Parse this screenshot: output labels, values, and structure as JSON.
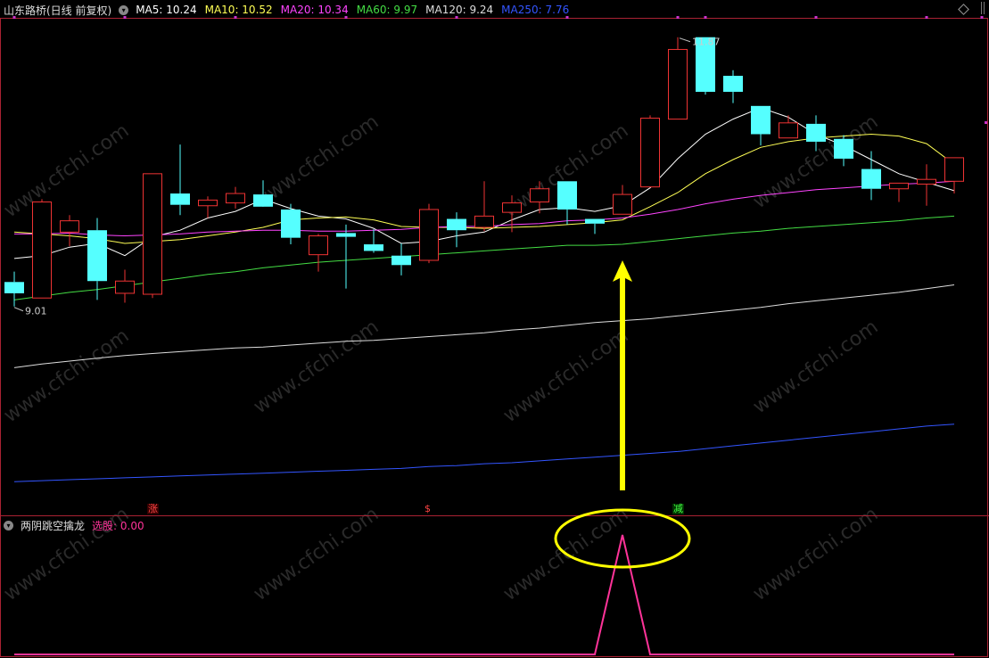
{
  "header": {
    "stock_title": "山东路桥(日线 前复权)",
    "ma_labels": [
      {
        "text": "MA5: 10.24",
        "color": "#ffffff"
      },
      {
        "text": "MA10: 10.52",
        "color": "#ffff55"
      },
      {
        "text": "MA20: 10.34",
        "color": "#ff44ff"
      },
      {
        "text": "MA60: 9.97",
        "color": "#44dd44"
      },
      {
        "text": "MA120: 9.24",
        "color": "#dddddd"
      },
      {
        "text": "MA250: 7.76",
        "color": "#3355ff"
      }
    ]
  },
  "indicator_panel": {
    "title": "两阴跳空擒龙",
    "value_label": "选股: 0.00",
    "value_color": "#ff3399"
  },
  "annotations": {
    "high_price": "11.87",
    "low_price": "9.01",
    "signal_zhang": "涨",
    "signal_s": "$",
    "signal_jian": "减"
  },
  "watermark": "www.cfchi.com",
  "colors": {
    "up": "#ee3333",
    "down": "#55ffff",
    "ma5": "#ffffff",
    "ma10": "#ffff55",
    "ma20": "#ff44ff",
    "ma60": "#44dd44",
    "ma120": "#dddddd",
    "ma250": "#3355ff",
    "indicator": "#ff3399",
    "highlight": "#ffff00",
    "frame": "#aa2233"
  },
  "chart_data": {
    "type": "candlestick",
    "candles": [
      {
        "o": 9.27,
        "h": 9.38,
        "l": 9.01,
        "c": 9.15
      },
      {
        "o": 9.1,
        "h": 10.15,
        "l": 9.1,
        "c": 10.12
      },
      {
        "o": 9.8,
        "h": 9.98,
        "l": 9.65,
        "c": 9.92
      },
      {
        "o": 9.82,
        "h": 9.95,
        "l": 9.08,
        "c": 9.28
      },
      {
        "o": 9.15,
        "h": 9.4,
        "l": 9.05,
        "c": 9.28
      },
      {
        "o": 9.14,
        "h": 10.42,
        "l": 9.1,
        "c": 10.42
      },
      {
        "o": 10.21,
        "h": 10.73,
        "l": 9.98,
        "c": 10.09
      },
      {
        "o": 10.08,
        "h": 10.18,
        "l": 9.95,
        "c": 10.14
      },
      {
        "o": 10.11,
        "h": 10.28,
        "l": 10.05,
        "c": 10.21
      },
      {
        "o": 10.2,
        "h": 10.35,
        "l": 10.08,
        "c": 10.07
      },
      {
        "o": 10.04,
        "h": 10.1,
        "l": 9.67,
        "c": 9.74
      },
      {
        "o": 9.56,
        "h": 9.78,
        "l": 9.38,
        "c": 9.76
      },
      {
        "o": 9.79,
        "h": 9.88,
        "l": 9.2,
        "c": 9.75
      },
      {
        "o": 9.67,
        "h": 9.83,
        "l": 9.58,
        "c": 9.6
      },
      {
        "o": 9.55,
        "h": 9.68,
        "l": 9.34,
        "c": 9.45
      },
      {
        "o": 9.5,
        "h": 10.1,
        "l": 9.47,
        "c": 10.04
      },
      {
        "o": 9.94,
        "h": 10.01,
        "l": 9.64,
        "c": 9.82
      },
      {
        "o": 9.85,
        "h": 10.34,
        "l": 9.81,
        "c": 9.97
      },
      {
        "o": 10.01,
        "h": 10.19,
        "l": 9.8,
        "c": 10.11
      },
      {
        "o": 10.12,
        "h": 10.34,
        "l": 10.0,
        "c": 10.26
      },
      {
        "o": 10.34,
        "h": 10.34,
        "l": 9.88,
        "c": 10.04
      },
      {
        "o": 9.94,
        "h": 9.94,
        "l": 9.78,
        "c": 9.89
      },
      {
        "o": 9.99,
        "h": 10.3,
        "l": 9.99,
        "c": 10.2
      },
      {
        "o": 10.28,
        "h": 11.04,
        "l": 10.28,
        "c": 11.01
      },
      {
        "o": 11.0,
        "h": 11.87,
        "l": 11.0,
        "c": 11.74
      },
      {
        "o": 11.87,
        "h": 11.87,
        "l": 11.26,
        "c": 11.29
      },
      {
        "o": 11.46,
        "h": 11.52,
        "l": 11.17,
        "c": 11.29
      },
      {
        "o": 11.14,
        "h": 11.14,
        "l": 10.72,
        "c": 10.84
      },
      {
        "o": 10.8,
        "h": 11.04,
        "l": 10.8,
        "c": 10.96
      },
      {
        "o": 10.95,
        "h": 11.04,
        "l": 10.66,
        "c": 10.76
      },
      {
        "o": 10.79,
        "h": 10.83,
        "l": 10.5,
        "c": 10.58
      },
      {
        "o": 10.47,
        "h": 10.66,
        "l": 10.14,
        "c": 10.26
      },
      {
        "o": 10.26,
        "h": 10.32,
        "l": 10.12,
        "c": 10.32
      },
      {
        "o": 10.31,
        "h": 10.52,
        "l": 10.08,
        "c": 10.36
      },
      {
        "o": 10.34,
        "h": 10.59,
        "l": 10.21,
        "c": 10.59
      }
    ],
    "ma_series": [
      {
        "name": "MA5",
        "values": [
          9.52,
          9.55,
          9.64,
          9.68,
          9.55,
          9.75,
          9.82,
          9.95,
          10.02,
          10.15,
          10.05,
          9.97,
          9.94,
          9.84,
          9.68,
          9.7,
          9.76,
          9.8,
          9.93,
          10.04,
          10.06,
          10.02,
          10.08,
          10.27,
          10.58,
          10.84,
          11.0,
          11.12,
          11.02,
          10.84,
          10.72,
          10.57,
          10.42,
          10.33,
          10.24
        ]
      },
      {
        "name": "MA10",
        "values": [
          9.8,
          9.78,
          9.76,
          9.73,
          9.68,
          9.7,
          9.72,
          9.76,
          9.8,
          9.85,
          9.93,
          9.95,
          9.96,
          9.93,
          9.86,
          9.85,
          9.85,
          9.84,
          9.85,
          9.86,
          9.88,
          9.9,
          9.93,
          10.07,
          10.22,
          10.42,
          10.57,
          10.7,
          10.76,
          10.8,
          10.82,
          10.84,
          10.82,
          10.74,
          10.52
        ]
      },
      {
        "name": "MA20",
        "values": [
          9.78,
          9.78,
          9.79,
          9.77,
          9.76,
          9.77,
          9.78,
          9.8,
          9.81,
          9.82,
          9.82,
          9.81,
          9.81,
          9.82,
          9.83,
          9.85,
          9.86,
          9.86,
          9.88,
          9.89,
          9.92,
          9.93,
          9.95,
          9.99,
          10.04,
          10.1,
          10.15,
          10.19,
          10.22,
          10.25,
          10.27,
          10.29,
          10.31,
          10.32,
          10.34
        ]
      },
      {
        "name": "MA60",
        "values": [
          9.08,
          9.12,
          9.16,
          9.19,
          9.23,
          9.27,
          9.31,
          9.35,
          9.38,
          9.42,
          9.45,
          9.48,
          9.5,
          9.52,
          9.54,
          9.56,
          9.58,
          9.6,
          9.62,
          9.64,
          9.66,
          9.66,
          9.67,
          9.7,
          9.73,
          9.76,
          9.79,
          9.81,
          9.84,
          9.86,
          9.88,
          9.9,
          9.92,
          9.95,
          9.97
        ]
      },
      {
        "name": "MA120",
        "values": [
          8.36,
          8.4,
          8.43,
          8.46,
          8.49,
          8.51,
          8.53,
          8.55,
          8.57,
          8.58,
          8.6,
          8.62,
          8.64,
          8.65,
          8.67,
          8.69,
          8.71,
          8.73,
          8.76,
          8.78,
          8.81,
          8.84,
          8.86,
          8.88,
          8.91,
          8.94,
          8.97,
          9.0,
          9.04,
          9.07,
          9.1,
          9.13,
          9.16,
          9.2,
          9.24
        ]
      },
      {
        "name": "MA250",
        "values": [
          7.15,
          7.16,
          7.17,
          7.18,
          7.19,
          7.2,
          7.21,
          7.22,
          7.23,
          7.24,
          7.25,
          7.26,
          7.27,
          7.28,
          7.29,
          7.31,
          7.32,
          7.34,
          7.35,
          7.37,
          7.39,
          7.41,
          7.43,
          7.45,
          7.47,
          7.5,
          7.53,
          7.56,
          7.59,
          7.62,
          7.65,
          7.68,
          7.71,
          7.74,
          7.76
        ]
      }
    ],
    "indicator": {
      "name": "选股",
      "values": [
        0,
        0,
        0,
        0,
        0,
        0,
        0,
        0,
        0,
        0,
        0,
        0,
        0,
        0,
        0,
        0,
        0,
        0,
        0,
        0,
        0,
        0,
        1,
        0,
        0,
        0,
        0,
        0,
        0,
        0,
        0,
        0,
        0,
        0,
        0
      ]
    },
    "signals": [
      {
        "index": 5,
        "text_key": "signal_zhang"
      },
      {
        "index": 15,
        "text_key": "signal_s"
      },
      {
        "index": 24,
        "text_key": "signal_jian"
      }
    ],
    "ylim": [
      7.0,
      12.0
    ],
    "grid": false
  }
}
